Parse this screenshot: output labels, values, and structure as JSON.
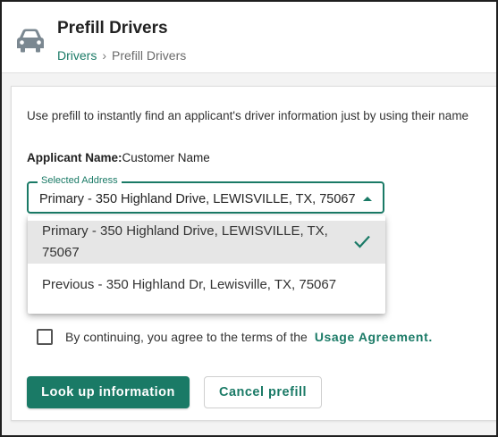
{
  "header": {
    "icon": "car-icon",
    "title": "Prefill Drivers",
    "breadcrumb": {
      "link": "Drivers",
      "separator": "›",
      "current": "Prefill Drivers"
    }
  },
  "card": {
    "intro": "Use prefill to instantly find an applicant's driver information just by using their name",
    "applicant": {
      "label": "Applicant Name:",
      "value": "Customer Name"
    },
    "address_select": {
      "label": "Selected Address",
      "value": "Primary - 350 Highland Drive, LEWISVILLE, TX, 75067",
      "options": [
        {
          "label": "Primary - 350 Highland Drive, LEWISVILLE, TX, 75067",
          "selected": true
        },
        {
          "label": "Previous - 350 Highland Dr, Lewisville, TX, 75067",
          "selected": false
        }
      ]
    },
    "agreement": {
      "text": "By continuing, you agree to the terms of the",
      "link": "Usage Agreement.",
      "checked": false
    },
    "buttons": {
      "lookup": "Look up information",
      "cancel": "Cancel prefill"
    }
  },
  "colors": {
    "accent": "#1a7a66",
    "icon_gray": "#7b8891",
    "selected_option_bg": "#e6e6e6"
  }
}
